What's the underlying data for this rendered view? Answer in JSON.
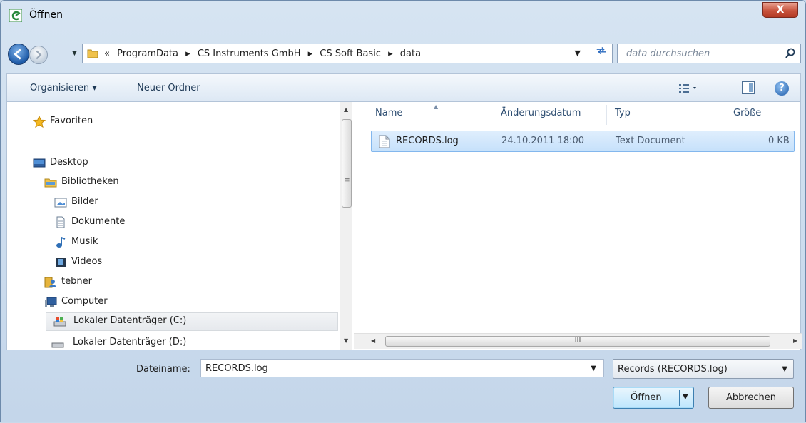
{
  "window": {
    "title": "Öffnen",
    "close_glyph": "X"
  },
  "nav": {
    "breadcrumbs": [
      "«",
      "ProgramData",
      "▸",
      "CS Instruments GmbH",
      "▸",
      "CS Soft Basic",
      "▸",
      "data"
    ],
    "search_placeholder": "data durchsuchen",
    "refresh_glyph": "⁴"
  },
  "toolbar": {
    "organize": "Organisieren ▾",
    "new_folder": "Neuer Ordner",
    "help": "?"
  },
  "navtree": {
    "favorites": "Favoriten",
    "desktop": "Desktop",
    "libraries": "Bibliotheken",
    "pictures": "Bilder",
    "documents": "Dokumente",
    "music": "Musik",
    "videos": "Videos",
    "user": "tebner",
    "computer": "Computer",
    "drive_c": "Lokaler Datenträger (C:)",
    "drive_d": "Lokaler Datenträger (D:)"
  },
  "columns": {
    "name": "Name",
    "date": "Änderungsdatum",
    "type": "Typ",
    "size": "Größe"
  },
  "files": [
    {
      "name": "RECORDS.log",
      "date": "24.10.2011 18:00",
      "type": "Text Document",
      "size": "0 KB"
    }
  ],
  "bottom": {
    "filename_label": "Dateiname:",
    "filename_value": "RECORDS.log",
    "filter_value": "Records  (RECORDS.log)",
    "open_label": "Öffnen",
    "cancel_label": "Abbrechen"
  },
  "scroll_glyph": "III"
}
